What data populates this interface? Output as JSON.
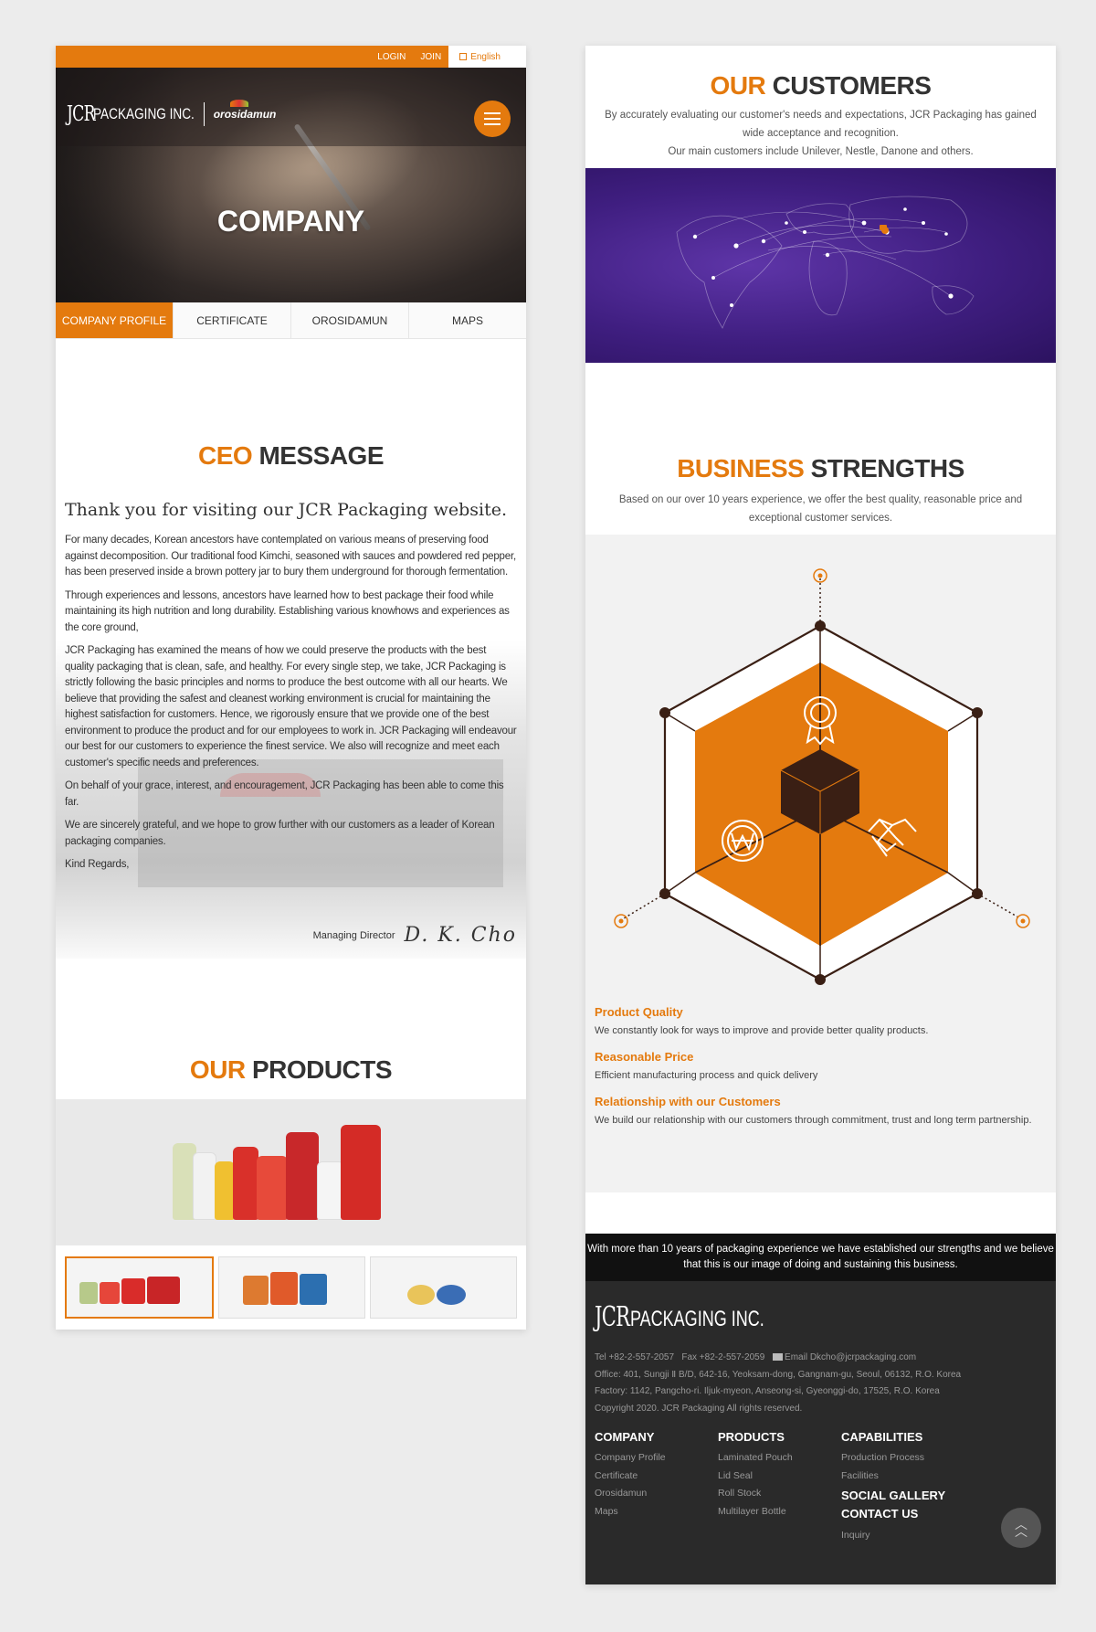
{
  "topbar": {
    "login": "LOGIN",
    "join": "JOIN",
    "lang": "English"
  },
  "header": {
    "logo_main": "JCR",
    "logo_sub": "PACKAGING INC.",
    "logo_brand": "orosidamun",
    "hero_title": "COMPANY"
  },
  "tabs": [
    {
      "label": "COMPANY PROFILE",
      "active": true
    },
    {
      "label": "CERTIFICATE",
      "active": false
    },
    {
      "label": "OROSIDAMUN",
      "active": false
    },
    {
      "label": "MAPS",
      "active": false
    }
  ],
  "ceo": {
    "title_accent": "CEO",
    "title_rest": "MESSAGE",
    "greeting": "Thank you for visiting our JCR Packaging website.",
    "paragraphs": [
      "For many decades, Korean ancestors have contemplated on various means of preserving food against decomposition. Our traditional food Kimchi, seasoned with sauces and powdered red pepper, has been preserved inside a brown pottery jar to bury them underground for thorough fermentation.",
      "Through experiences and lessons, ancestors have learned how to best package their food while maintaining its high nutrition and long durability. Establishing various knowhows and experiences as the core ground,",
      "JCR Packaging has examined the means of how we could preserve the products with the best quality packaging that is clean, safe, and healthy. For every single step, we take, JCR Packaging is strictly following the basic principles and norms to produce the best outcome with all our hearts. We believe that providing the safest and cleanest working environment is crucial for maintaining the highest satisfaction for customers. Hence, we rigorously ensure that we provide one of the best environment to produce the product and for our employees to work in. JCR Packaging will endeavour our best for our customers to experience the finest service. We also will recognize and meet each customer's specific needs and preferences.",
      "On behalf of your grace, interest, and encouragement, JCR Packaging has been able to come this far.",
      "We are sincerely grateful, and we hope to grow further with our customers as a leader of Korean packaging companies.",
      "Kind Regards,"
    ],
    "signer_title": "Managing Director",
    "signature": "D. K. Cho"
  },
  "products": {
    "title_accent": "OUR",
    "title_rest": "PRODUCTS"
  },
  "customers": {
    "title_accent": "OUR",
    "title_rest": "CUSTOMERS",
    "line1": "By accurately evaluating our customer's needs and expectations, JCR Packaging has gained wide acceptance and recognition.",
    "line2": "Our main customers include Unilever, Nestle, Danone and others."
  },
  "strengths": {
    "title_accent": "BUSINESS",
    "title_rest": "STRENGTHS",
    "subtitle": "Based on our over 10 years experience, we offer the best quality, reasonable price and exceptional customer services.",
    "items": [
      {
        "title": "Product Quality",
        "desc": "We constantly look for ways to improve and provide better quality products."
      },
      {
        "title": "Reasonable Price",
        "desc": "Efficient manufacturing process and quick delivery"
      },
      {
        "title": "Relationship with our Customers",
        "desc": "We build our relationship with our customers through commitment, trust and long term partnership."
      }
    ]
  },
  "banner": {
    "text": "With more than 10 years of packaging experience we have established our strengths and we believe that this is our image of doing and sustaining this business."
  },
  "footer": {
    "logo_main": "JCR",
    "logo_sub": "PACKAGING INC.",
    "tel": "Tel +82-2-557-2057",
    "fax": "Fax +82-2-557-2059",
    "email": "Email Dkcho@jcrpackaging.com",
    "office": "Office: 401, Sungji Ⅱ B/D, 642-16, Yeoksam-dong, Gangnam-gu, Seoul, 06132, R.O. Korea",
    "factory": "Factory: 1142, Pangcho-ri. Iljuk-myeon, Anseong-si, Gyeonggi-do, 17525, R.O. Korea",
    "copyright": "Copyright 2020. JCR Packaging All rights reserved.",
    "company": {
      "heading": "COMPANY",
      "links": [
        "Company Profile",
        "Certificate",
        "Orosidamun",
        "Maps"
      ]
    },
    "products": {
      "heading": "PRODUCTS",
      "links": [
        "Laminated Pouch",
        "Lid Seal",
        "Roll Stock",
        "Multilayer Bottle"
      ]
    },
    "capabilities": {
      "heading": "CAPABILITIES",
      "links": [
        "Production Process",
        "Facilities"
      ]
    },
    "social": {
      "heading": "SOCIAL GALLERY"
    },
    "contact": {
      "heading": "CONTACT US",
      "links": [
        "Inquiry"
      ]
    }
  },
  "colors": {
    "accent": "#e47a0e",
    "dark": "#2a2a2a",
    "hex_dark": "#3a1f14",
    "map_purple": "#3f1e80"
  },
  "icons": [
    "menu-icon",
    "world-map-icon",
    "award-icon",
    "won-coin-icon",
    "handshake-icon",
    "scroll-top-icon",
    "mail-icon"
  ]
}
